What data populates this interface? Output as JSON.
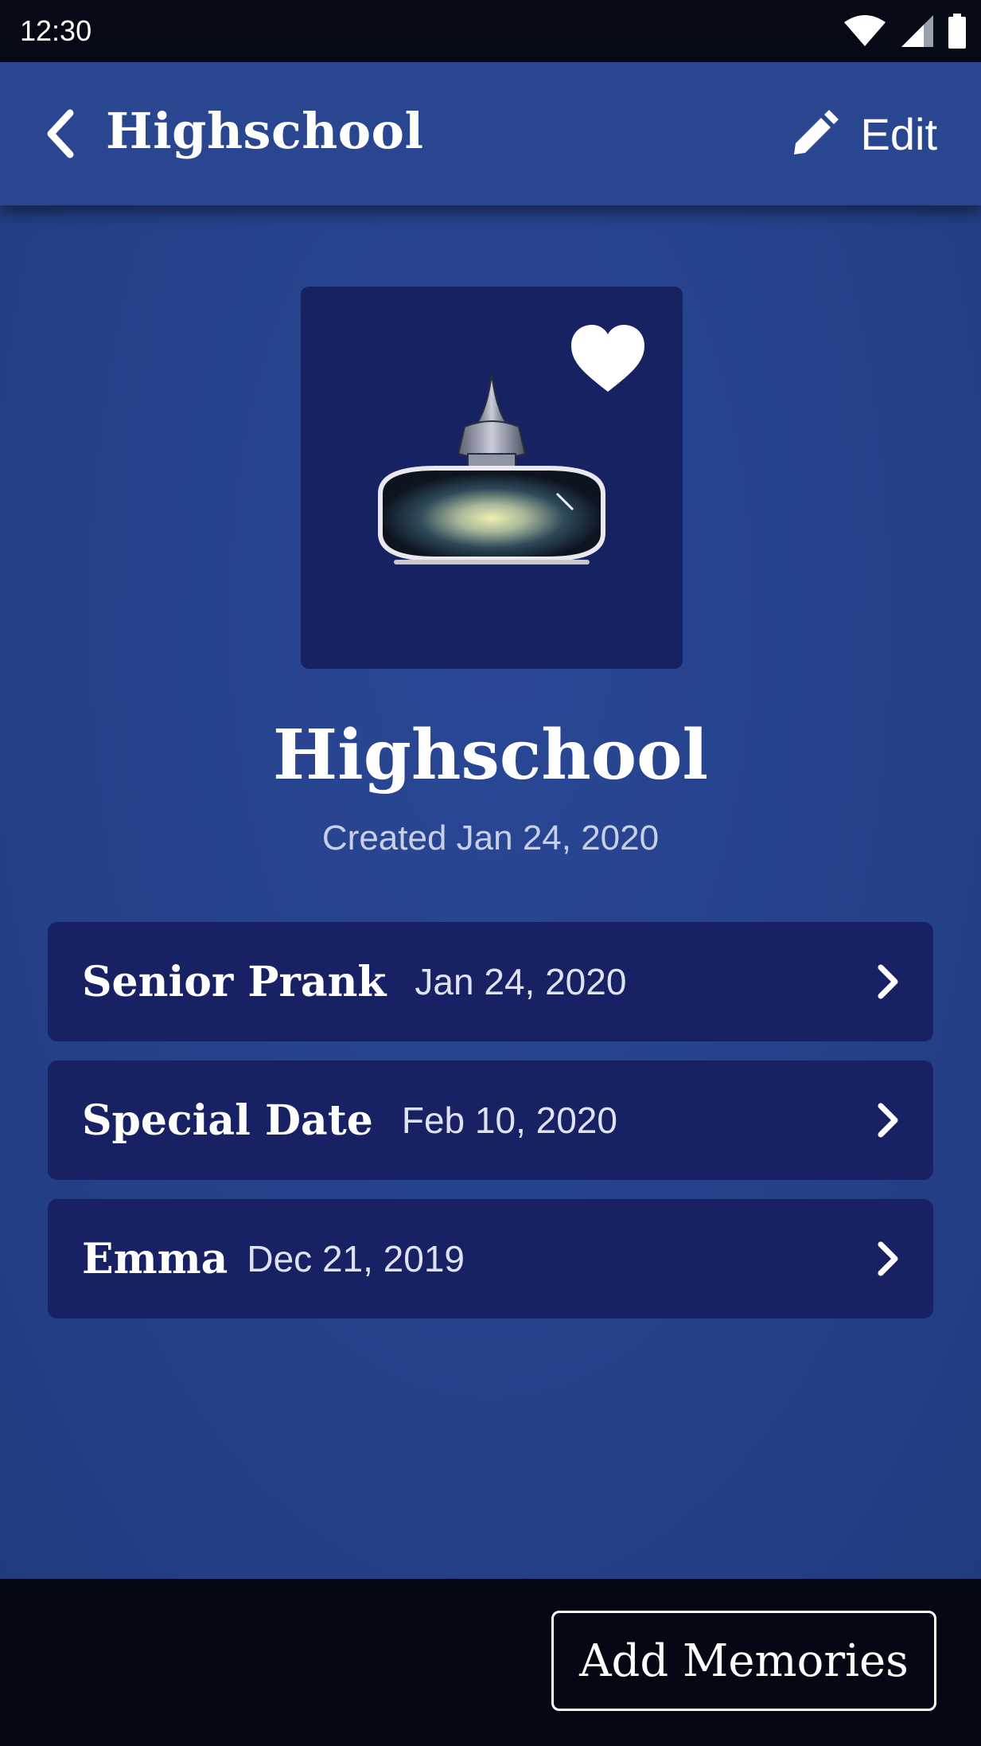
{
  "status_bar": {
    "time": "12:30",
    "icons": [
      "wifi-icon",
      "signal-icon",
      "battery-icon"
    ]
  },
  "app_bar": {
    "back_icon": "chevron-left-icon",
    "title": "Highschool",
    "edit_icon": "pencil-icon",
    "edit_label": "Edit"
  },
  "collection": {
    "image": "ink-bottle-jar-illustration",
    "favorite_icon": "heart-icon",
    "title": "Highschool",
    "created": "Created Jan 24, 2020"
  },
  "memories": [
    {
      "name": "Senior Prank",
      "date": "Jan 24, 2020"
    },
    {
      "name": "Special Date",
      "date": "Feb 10, 2020"
    },
    {
      "name": "Emma",
      "date": "Dec 21, 2019"
    }
  ],
  "bottom_bar": {
    "add_label": "Add Memories"
  },
  "colors": {
    "app_bar": "#2b4690",
    "background": "#25418a",
    "card": "#172163",
    "status_bar": "#060a16"
  }
}
